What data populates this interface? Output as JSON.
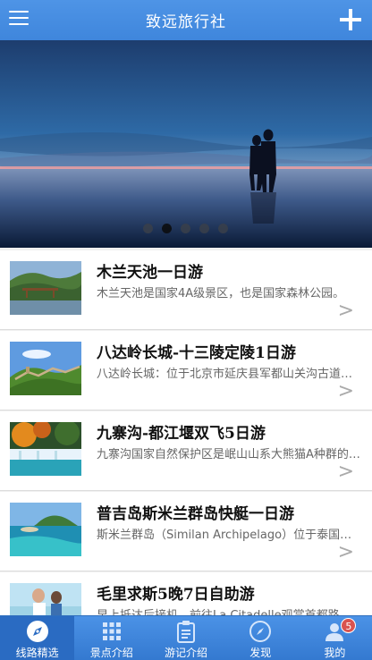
{
  "header": {
    "title": "致远旅行社",
    "menu_icon": "hamburger-menu-icon",
    "add_icon": "plus-icon"
  },
  "banner": {
    "slide_count": 5,
    "active_slide": 1
  },
  "trips": [
    {
      "title": "木兰天池一日游",
      "desc": "木兰天池是国家4A级景区，也是国家森林公园。"
    },
    {
      "title": "八达岭长城-十三陵定陵1日游",
      "desc": "八达岭长城：位于北京市延庆县军都山关沟古道北口。"
    },
    {
      "title": "九寨沟-都江堰双飞5日游",
      "desc": "九寨沟国家自然保护区是岷山山系大熊猫A种群的核心。"
    },
    {
      "title": "普吉岛斯米兰群岛快艇一日游",
      "desc": "斯米兰群岛（Similan Archipelago）位于泰国攀牙府。"
    },
    {
      "title": "毛里求斯5晚7日自助游",
      "desc": "早上抵达后接机，前往La Citadelle观赏首都路易港。"
    }
  ],
  "tabs": [
    {
      "label": "线路精选",
      "icon": "compass-icon",
      "active": true
    },
    {
      "label": "景点介绍",
      "icon": "grid-icon",
      "active": false
    },
    {
      "label": "游记介绍",
      "icon": "clipboard-icon",
      "active": false
    },
    {
      "label": "发现",
      "icon": "discover-icon",
      "active": false
    },
    {
      "label": "我的",
      "icon": "user-icon",
      "active": false,
      "badge": "5"
    }
  ],
  "colors": {
    "header": "#4a90e2",
    "tabbar": "#3b82d9",
    "badge": "#d9534f"
  }
}
